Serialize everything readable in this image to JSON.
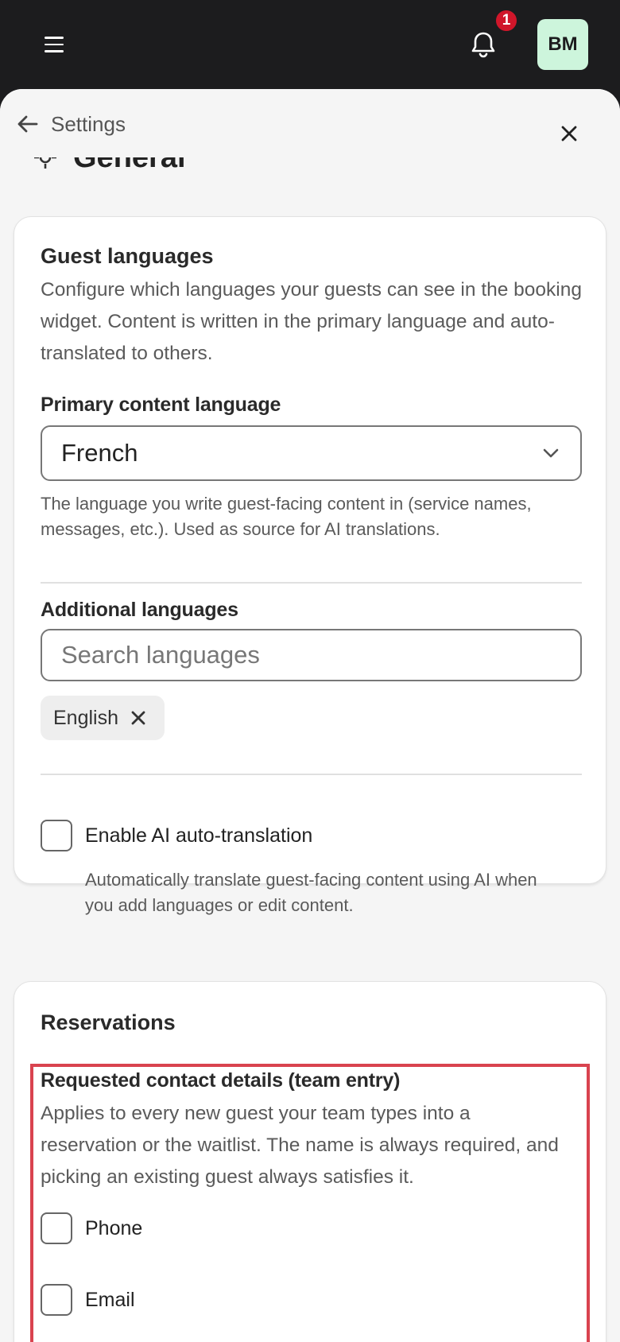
{
  "header": {
    "notification_count": "1",
    "avatar_initials": "BM"
  },
  "sheet": {
    "back_label": "Settings",
    "section_title": "General"
  },
  "guest_languages": {
    "title": "Guest languages",
    "description": "Configure which languages your guests can see in the booking widget. Content is written in the primary language and auto-translated to others.",
    "primary_label": "Primary content language",
    "primary_value": "French",
    "primary_helper": "The language you write guest-facing content in (service names, messages, etc.). Used as source for AI translations.",
    "additional_label": "Additional languages",
    "search_placeholder": "Search languages",
    "selected_languages": [
      "English"
    ],
    "auto_translate_label": "Enable AI auto-translation",
    "auto_translate_checked": false,
    "auto_translate_helper": "Automatically translate guest-facing content using AI when you add languages or edit content."
  },
  "reservations": {
    "title": "Reservations",
    "contact_title": "Requested contact details (team entry)",
    "contact_description": "Applies to every new guest your team types into a reservation or the waitlist. The name is always required, and picking an existing guest always satisfies it.",
    "options": [
      {
        "label": "Phone",
        "checked": false
      },
      {
        "label": "Email",
        "checked": false
      }
    ]
  },
  "colors": {
    "topbar": "#1c1c1e",
    "badge": "#d0162a",
    "avatar_bg": "#cdf5dc",
    "highlight_border": "#d9434f"
  }
}
